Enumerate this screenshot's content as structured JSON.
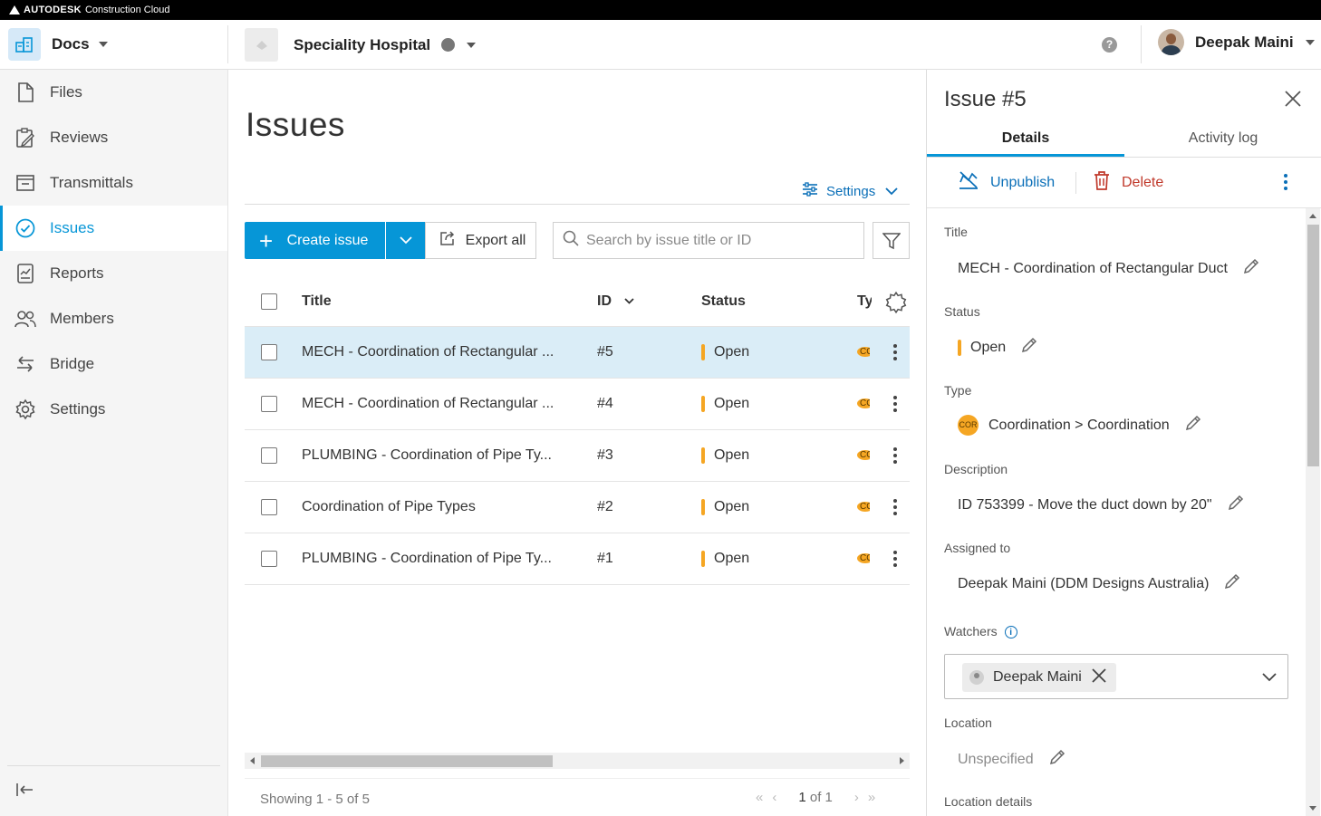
{
  "topbar": {
    "brand": "AUTODESK",
    "product": "Construction Cloud"
  },
  "header": {
    "app_name": "Docs",
    "project_name": "Speciality Hospital",
    "help_label": "?",
    "user_name": "Deepak Maini"
  },
  "sidebar": {
    "items": [
      {
        "label": "Files",
        "icon": "file-icon"
      },
      {
        "label": "Reviews",
        "icon": "reviews-icon"
      },
      {
        "label": "Transmittals",
        "icon": "transmittals-icon"
      },
      {
        "label": "Issues",
        "icon": "issues-icon",
        "active": true
      },
      {
        "label": "Reports",
        "icon": "reports-icon"
      },
      {
        "label": "Members",
        "icon": "members-icon"
      },
      {
        "label": "Bridge",
        "icon": "bridge-icon"
      },
      {
        "label": "Settings",
        "icon": "settings-icon"
      }
    ]
  },
  "main": {
    "title": "Issues",
    "settings_label": "Settings",
    "create_label": "Create issue",
    "export_label": "Export all",
    "search_placeholder": "Search by issue title or ID",
    "columns": {
      "title": "Title",
      "id": "ID",
      "status": "Status",
      "type": "Ty"
    },
    "rows": [
      {
        "title": "MECH - Coordination of Rectangular ...",
        "id": "#5",
        "status": "Open",
        "type_abbr": "CO",
        "selected": true
      },
      {
        "title": "MECH - Coordination of Rectangular ...",
        "id": "#4",
        "status": "Open",
        "type_abbr": "CO"
      },
      {
        "title": "PLUMBING - Coordination of Pipe Ty...",
        "id": "#3",
        "status": "Open",
        "type_abbr": "CO"
      },
      {
        "title": "Coordination of Pipe Types",
        "id": "#2",
        "status": "Open",
        "type_abbr": "CO"
      },
      {
        "title": "PLUMBING - Coordination of Pipe Ty...",
        "id": "#1",
        "status": "Open",
        "type_abbr": "CO"
      }
    ],
    "showing": "Showing 1 - 5 of 5",
    "page_current": "1",
    "page_of": "of 1"
  },
  "panel": {
    "title": "Issue #5",
    "tabs": [
      "Details",
      "Activity log"
    ],
    "unpublish_label": "Unpublish",
    "delete_label": "Delete",
    "fields": {
      "title_label": "Title",
      "title_value": "MECH - Coordination of Rectangular Duct",
      "status_label": "Status",
      "status_value": "Open",
      "type_label": "Type",
      "type_badge": "COR",
      "type_value": "Coordination > Coordination",
      "description_label": "Description",
      "description_value": "ID 753399 - Move the duct down by 20\"",
      "assigned_label": "Assigned to",
      "assigned_value": "Deepak Maini (DDM Designs Australia)",
      "watchers_label": "Watchers",
      "watcher_name": "Deepak Maini",
      "location_label": "Location",
      "location_value": "Unspecified",
      "location_details_label": "Location details"
    }
  },
  "colors": {
    "accent": "#0696d7",
    "status_open": "#f5a623",
    "delete": "#c0392b",
    "selected_row": "#daedf7"
  }
}
